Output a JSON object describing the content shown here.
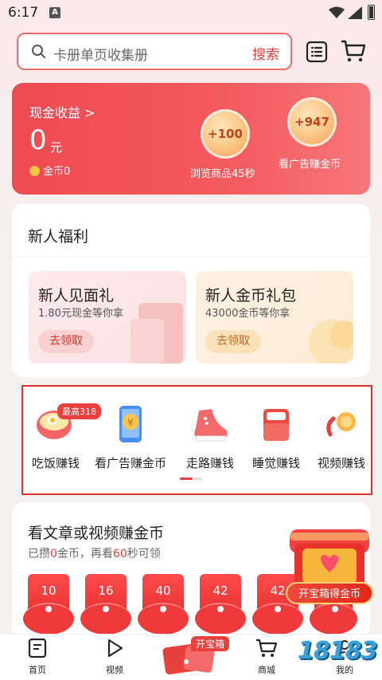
{
  "status_bar": {
    "time": "6:17",
    "notification": "A"
  },
  "search": {
    "placeholder": "卡册单页收集册",
    "button": "搜索"
  },
  "earnings": {
    "label": "现金收益 >",
    "amount": "0",
    "unit": "元",
    "coins": "金币0",
    "tasks": [
      {
        "reward": "+100",
        "caption": "浏览商品45秒"
      },
      {
        "reward": "+947",
        "caption": "看广告赚金币"
      }
    ]
  },
  "welfare": {
    "title": "新人福利",
    "cards": [
      {
        "title": "新人见面礼",
        "subtitle": "1.80元现金等你拿",
        "button": "去领取"
      },
      {
        "title": "新人金币礼包",
        "subtitle": "43000金币等你拿",
        "button": "去领取"
      }
    ]
  },
  "features": {
    "badge": "最高318",
    "items": [
      {
        "label": "吃饭赚钱",
        "icon": "rice-bowl-icon"
      },
      {
        "label": "看广告赚金币",
        "icon": "phone-coin-icon"
      },
      {
        "label": "走路赚钱",
        "icon": "sneaker-icon"
      },
      {
        "label": "睡觉赚钱",
        "icon": "bed-icon"
      },
      {
        "label": "视频赚钱",
        "icon": "video-coin-icon"
      }
    ]
  },
  "article": {
    "title": "看文章或视频赚金币",
    "sub_prefix": "已攒",
    "sub_count": "0",
    "sub_mid": "金币，再看",
    "sub_secs": "60",
    "sub_suffix": "秒可领",
    "envelopes": [
      "10",
      "16",
      "40",
      "42",
      "42"
    ],
    "chest_label": "开宝箱得金币"
  },
  "bottom_nav": {
    "items": [
      {
        "label": "首页",
        "icon": "home-doc-icon"
      },
      {
        "label": "视频",
        "icon": "play-icon"
      },
      {
        "label": "商城",
        "icon": "cart-icon"
      },
      {
        "label": "我的",
        "icon": "profile-icon"
      }
    ],
    "center_tag": "开宝箱"
  },
  "watermark": "18183",
  "colors": {
    "accent": "#e8403c",
    "card_red": "#f04a52",
    "coin": "#f5c24a"
  }
}
